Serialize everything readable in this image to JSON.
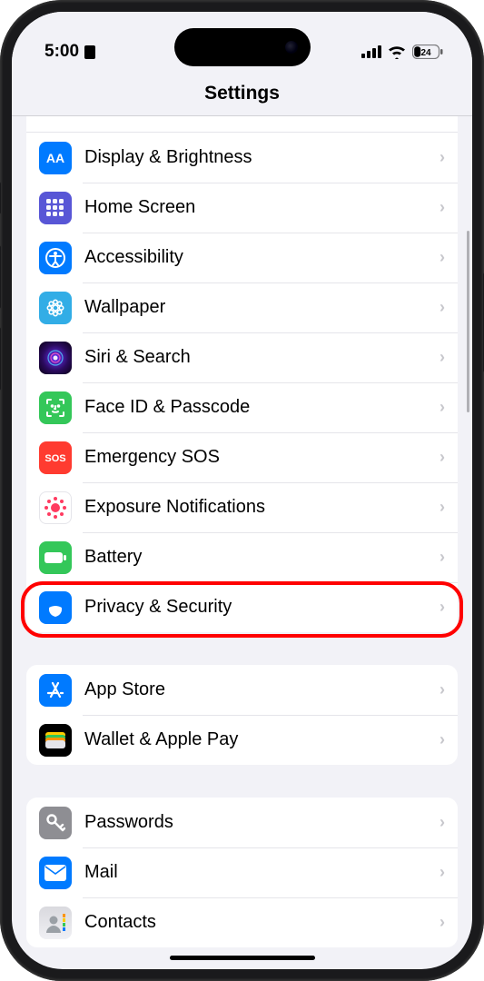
{
  "statusBar": {
    "time": "5:00",
    "batteryPercent": "24"
  },
  "header": {
    "title": "Settings"
  },
  "groups": [
    {
      "items": [
        {
          "key": "display",
          "label": "Display & Brightness",
          "icon": "display-icon",
          "bg": "bg-blue"
        },
        {
          "key": "home",
          "label": "Home Screen",
          "icon": "home-screen-icon",
          "bg": "bg-indigo"
        },
        {
          "key": "accessibility",
          "label": "Accessibility",
          "icon": "accessibility-icon",
          "bg": "bg-blue"
        },
        {
          "key": "wallpaper",
          "label": "Wallpaper",
          "icon": "wallpaper-icon",
          "bg": "bg-cyan"
        },
        {
          "key": "siri",
          "label": "Siri & Search",
          "icon": "siri-icon",
          "bg": "siri-bg"
        },
        {
          "key": "faceid",
          "label": "Face ID & Passcode",
          "icon": "faceid-icon",
          "bg": "bg-green"
        },
        {
          "key": "sos",
          "label": "Emergency SOS",
          "icon": "sos-icon",
          "bg": "bg-red"
        },
        {
          "key": "exposure",
          "label": "Exposure Notifications",
          "icon": "exposure-icon",
          "bg": "bg-white-red"
        },
        {
          "key": "battery",
          "label": "Battery",
          "icon": "battery-icon",
          "bg": "bg-green"
        },
        {
          "key": "privacy",
          "label": "Privacy & Security",
          "icon": "privacy-icon",
          "bg": "bg-blue",
          "highlighted": true
        }
      ]
    },
    {
      "items": [
        {
          "key": "appstore",
          "label": "App Store",
          "icon": "appstore-icon",
          "bg": "bg-blue"
        },
        {
          "key": "wallet",
          "label": "Wallet & Apple Pay",
          "icon": "wallet-icon",
          "bg": "bg-black"
        }
      ]
    },
    {
      "items": [
        {
          "key": "passwords",
          "label": "Passwords",
          "icon": "passwords-icon",
          "bg": "bg-gray"
        },
        {
          "key": "mail",
          "label": "Mail",
          "icon": "mail-icon",
          "bg": "bg-blue"
        },
        {
          "key": "contacts",
          "label": "Contacts",
          "icon": "contacts-icon",
          "bg": "contacts-bg"
        }
      ]
    }
  ],
  "highlightColor": "#ff0000"
}
